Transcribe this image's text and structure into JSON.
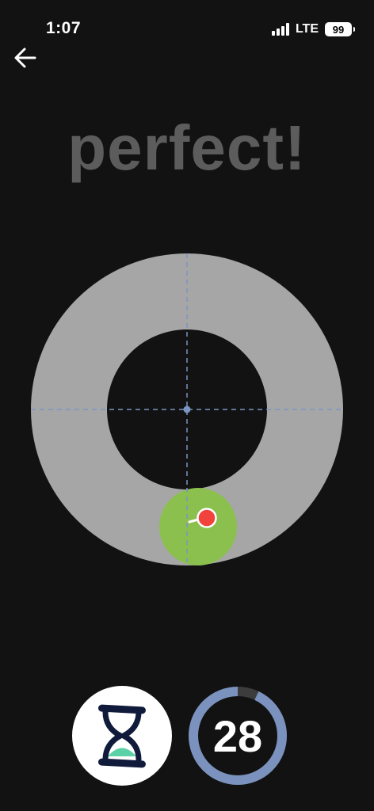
{
  "status_bar": {
    "time": "1:07",
    "network": "LTE",
    "battery": "99",
    "signal_icon": "cellular-signal-icon"
  },
  "navigation": {
    "back_icon": "arrow-left-icon"
  },
  "feedback": {
    "text": "perfect!"
  },
  "game": {
    "ring_color": "#a6a6a6",
    "inner_color": "#121212",
    "crosshair_color": "#7b94c2",
    "target_color": "#8bc04f",
    "marker_color": "#f2423c"
  },
  "controls": {
    "timer_icon": "hourglass-icon",
    "hourglass_sand_color": "#5bd1a8",
    "counter_value": "28",
    "counter_ring_color": "#7a92bd",
    "counter_track_color": "#3c3c3c",
    "counter_progress": 0.93
  }
}
